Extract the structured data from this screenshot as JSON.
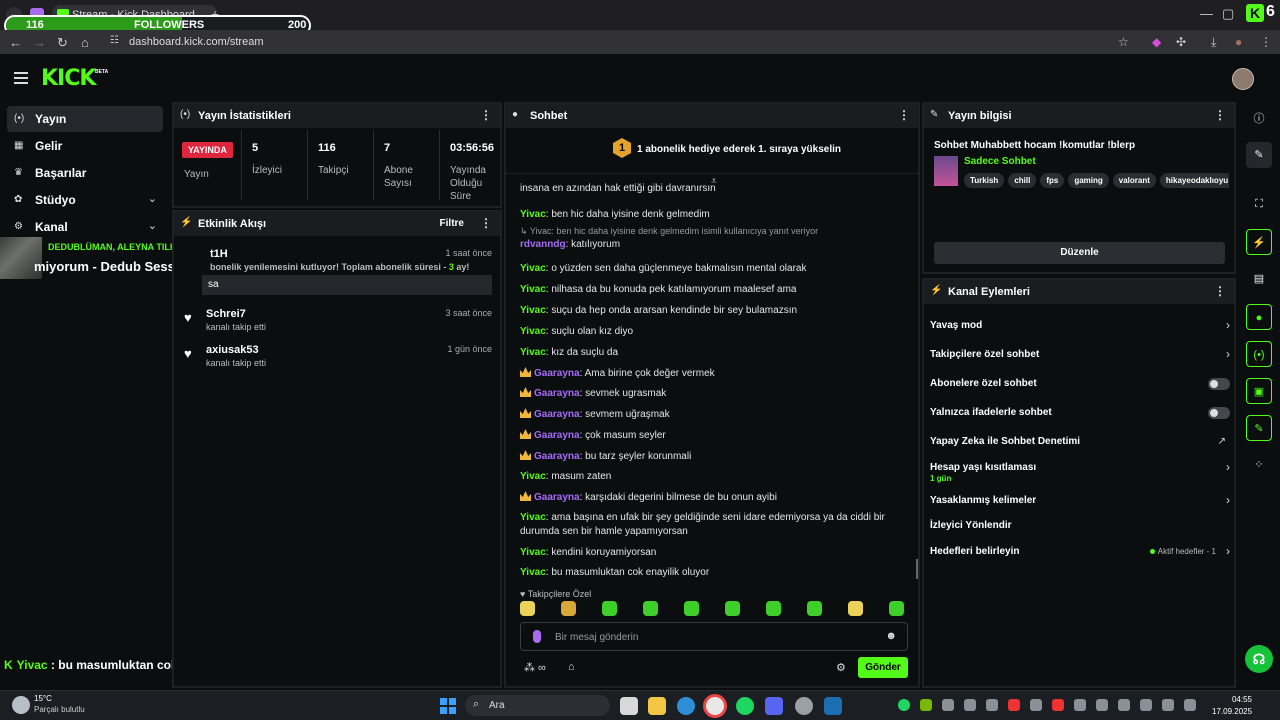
{
  "browser": {
    "tab_title": "Stream - Kick Dashboard",
    "url": "dashboard.kick.com/stream",
    "followers_goal": {
      "current": "116",
      "label": "FOLLOWERS",
      "target": "200",
      "progress": 0.58
    },
    "corner_badge": "6"
  },
  "header": {
    "logo": "KICK",
    "beta": "BETA"
  },
  "sidebar": {
    "items": [
      {
        "label": "Yayın",
        "icon": "broadcast-icon",
        "active": true
      },
      {
        "label": "Gelir",
        "icon": "revenue-icon"
      },
      {
        "label": "Başarılar",
        "icon": "trophy-icon"
      },
      {
        "label": "Stüdyo",
        "icon": "studio-icon",
        "chevron": true
      },
      {
        "label": "Kanal",
        "icon": "channel-icon",
        "chevron": true
      }
    ]
  },
  "overlay": {
    "top_line": "DEDUBLÜMAN, ALEYNA TILKI",
    "bottom_line": "miyorum - Dedub Sessions",
    "chat_user": "Yivac",
    "chat_text": " : bu masumluktan cok enayilik oluyor"
  },
  "stats": {
    "title": "Yayın İstatistikleri",
    "live": "YAYINDA",
    "live_label": "Yayın",
    "cols": [
      {
        "value": "5",
        "label": "İzleyici"
      },
      {
        "value": "116",
        "label": "Takipçi"
      },
      {
        "value": "7",
        "label": "Abone Sayısı"
      },
      {
        "value": "03:56:56",
        "label": "Yayında Olduğu Süre"
      }
    ]
  },
  "activity": {
    "title": "Etkinlik Akışı",
    "filter": "Filtre",
    "items": [
      {
        "name": "t1H",
        "sub": "bonelik yenilemesini kutluyor! Toplam abonelik süresi - ",
        "months": "3",
        "months_suffix": " ay!",
        "time": "1 saat önce",
        "message": "sa"
      },
      {
        "name": "Schrei7",
        "sub": "kanalı takip etti",
        "time": "3 saat önce"
      },
      {
        "name": "axiusak53",
        "sub": "kanalı takip etti",
        "time": "1 gün önce"
      }
    ]
  },
  "chat": {
    "title": "Sohbet",
    "hype_rank": "1",
    "hype_text": "1 abonelik hediye ederek 1. sıraya yükselin",
    "partial_line": "insana en azından hak ettiği gibi davranırsın",
    "messages": [
      {
        "user": "Yivac",
        "color": "green",
        "text": "ben hic daha iyisine denk gelmedim"
      },
      {
        "reply": "Yivac: ben hic daha iyisine denk gelmedim isimli kullanıcıya yanıt veriyor",
        "user": "rdvanndg",
        "color": "purple",
        "text": "katılıyorum"
      },
      {
        "user": "Yivac",
        "color": "green",
        "text": "o yüzden sen daha güçlenmeye bakmalısın mental olarak"
      },
      {
        "user": "Yivac",
        "color": "green",
        "text": "nilhasa da bu konuda pek katılamıyorum maalesef ama"
      },
      {
        "user": "Yivac",
        "color": "green",
        "text": "suçu da hep onda ararsan kendinde bir sey bulamazsın"
      },
      {
        "user": "Yivac",
        "color": "green",
        "text": "suçlu olan kız diyo"
      },
      {
        "user": "Yivac",
        "color": "green",
        "text": "kız da suçlu da"
      },
      {
        "user": "Gaarayna",
        "color": "purple",
        "crown": true,
        "text": "Ama birine çok değer vermek"
      },
      {
        "user": "Gaarayna",
        "color": "purple",
        "crown": true,
        "text": "sevmek ugrasmak"
      },
      {
        "user": "Gaarayna",
        "color": "purple",
        "crown": true,
        "text": "sevmem uğraşmak"
      },
      {
        "user": "Gaarayna",
        "color": "purple",
        "crown": true,
        "text": "çok masum seyler"
      },
      {
        "user": "Gaarayna",
        "color": "purple",
        "crown": true,
        "text": "bu tarz şeyler korunmali"
      },
      {
        "user": "Yivac",
        "color": "green",
        "text": "masum zaten"
      },
      {
        "user": "Gaarayna",
        "color": "purple",
        "crown": true,
        "text": "karşıdaki degerini bilmese de bu onun ayibi"
      },
      {
        "user": "Yivac",
        "color": "green",
        "text": "ama başına en ufak bir şey geldiğinde seni idare edemiyorsa ya da ciddi bir durumda sen bir hamle yapamıyorsan"
      },
      {
        "user": "Yivac",
        "color": "green",
        "text": "kendini koruyamiyorsan"
      },
      {
        "user": "Yivac",
        "color": "green",
        "text": "bu masumluktan cok enayilik oluyor"
      }
    ],
    "followers_only": "Takipçilere Özel",
    "placeholder": "Bir mesaj gönderin",
    "send": "Gönder"
  },
  "stream_info": {
    "title": "Yayın bilgisi",
    "stream_title": "Sohbet Muhabbett hocam !komutlar !blerp",
    "category": "Sadece Sohbet",
    "tags": [
      "Turkish",
      "chill",
      "fps",
      "gaming",
      "valorant",
      "hikayeodaklıoyu"
    ],
    "edit": "Düzenle"
  },
  "channel_actions": {
    "title": "Kanal Eylemleri",
    "rows": [
      {
        "label": "Yavaş mod",
        "type": "chevron"
      },
      {
        "label": "Takipçilere özel sohbet",
        "type": "chevron"
      },
      {
        "label": "Abonelere özel sohbet",
        "type": "toggle"
      },
      {
        "label": "Yalnızca ifadelerle sohbet",
        "type": "toggle"
      },
      {
        "label": "Yapay Zeka ile Sohbet Denetimi",
        "type": "external"
      },
      {
        "label": "Hesap yaşı kısıtlaması",
        "sub": "1 gün",
        "type": "chevron"
      },
      {
        "label": "Yasaklanmış kelimeler",
        "type": "chevron"
      },
      {
        "label": "İzleyici Yönlendir",
        "type": "none"
      },
      {
        "label": "Hedefleri belirleyin",
        "goal": "Aktif hedefler - 1",
        "type": "chevron"
      }
    ]
  },
  "taskbar": {
    "temp": "15°C",
    "weather": "Parçalı bulutlu",
    "search": "Ara",
    "time": "04:55",
    "date": "17.09.2025"
  }
}
